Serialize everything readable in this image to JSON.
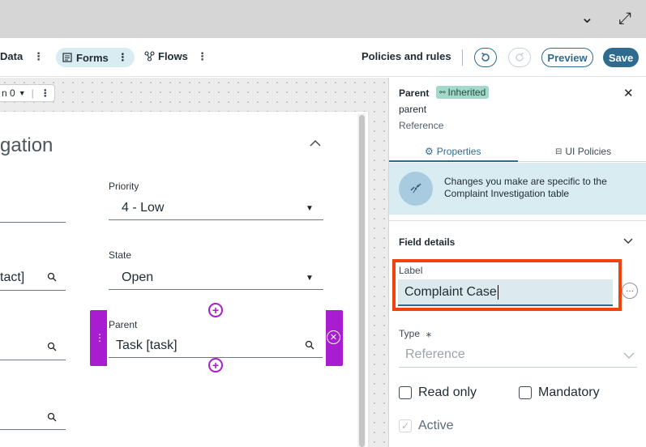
{
  "topbar": {
    "collapse_icon": "⌄",
    "expand_icon": "⤢"
  },
  "toolbar": {
    "items": [
      {
        "label": "Data"
      },
      {
        "label": "Forms",
        "icon": "form-icon"
      },
      {
        "label": "Flows",
        "icon": "flow-icon"
      }
    ],
    "policies_label": "Policies and rules",
    "preview_label": "Preview",
    "save_label": "Save",
    "more_glyph": "⋮"
  },
  "canvas": {
    "mini_toolbar_label": "n 0",
    "section_title": "gation",
    "fields": {
      "priority": {
        "label": "Priority",
        "value": "4 - Low"
      },
      "state": {
        "label": "State",
        "value": "Open"
      },
      "contact_partial": "tact]",
      "parent": {
        "label": "Parent",
        "value": "Task [task]"
      }
    }
  },
  "panel": {
    "title": "Parent",
    "badge": "Inherited",
    "field_name": "parent",
    "field_type": "Reference",
    "tabs": {
      "properties": "Properties",
      "ui_policies": "UI Policies"
    },
    "notice": "Changes you make are specific to the Complaint Investigation table",
    "field_details_title": "Field details",
    "label_caption": "Label",
    "label_value": "Complaint Case",
    "type_caption": "Type",
    "type_required_mark": "⁎",
    "type_value": "Reference",
    "checkboxes": {
      "read_only": "Read only",
      "mandatory": "Mandatory",
      "active": "Active"
    }
  },
  "colors": {
    "accent": "#2f6b8f",
    "selection": "#a81dcf",
    "highlight": "#f0420f",
    "badge": "#a4d8c8"
  }
}
